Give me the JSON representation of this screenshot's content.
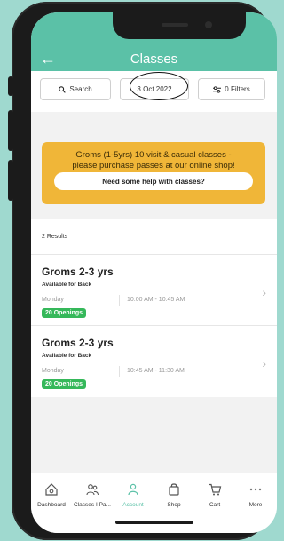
{
  "header": {
    "title": "Classes",
    "back_icon": "arrow-left-icon"
  },
  "toolbar": {
    "search_label": "Search",
    "date_label": "3 Oct 2022",
    "filters_label": "0 Filters"
  },
  "banner": {
    "text_line1": "Groms (1-5yrs) 10 visit & casual classes -",
    "text_line2": "please purchase passes at our online shop!",
    "help_button": "Need some help with classes?",
    "color": "#f0b638"
  },
  "results": {
    "count_label": "2 Results"
  },
  "classes": [
    {
      "title": "Groms 2-3 yrs",
      "subtitle": "Available for Back",
      "day": "Monday",
      "time": "10:00 AM - 10:45 AM",
      "openings": "20 Openings"
    },
    {
      "title": "Groms 2-3 yrs",
      "subtitle": "Available for Back",
      "day": "Monday",
      "time": "10:45 AM - 11:30 AM",
      "openings": "20 Openings"
    }
  ],
  "tabbar": {
    "items": [
      {
        "label": "Dashboard",
        "icon": "home-icon"
      },
      {
        "label": "Classes I Pa...",
        "icon": "people-icon"
      },
      {
        "label": "Account",
        "icon": "person-icon",
        "active": true
      },
      {
        "label": "Shop",
        "icon": "bag-icon"
      },
      {
        "label": "Cart",
        "icon": "cart-icon"
      },
      {
        "label": "More",
        "icon": "more-dots-icon"
      }
    ]
  },
  "colors": {
    "accent": "#5bc1a7",
    "badge": "#35b85a",
    "background": "#9fd9cf"
  }
}
